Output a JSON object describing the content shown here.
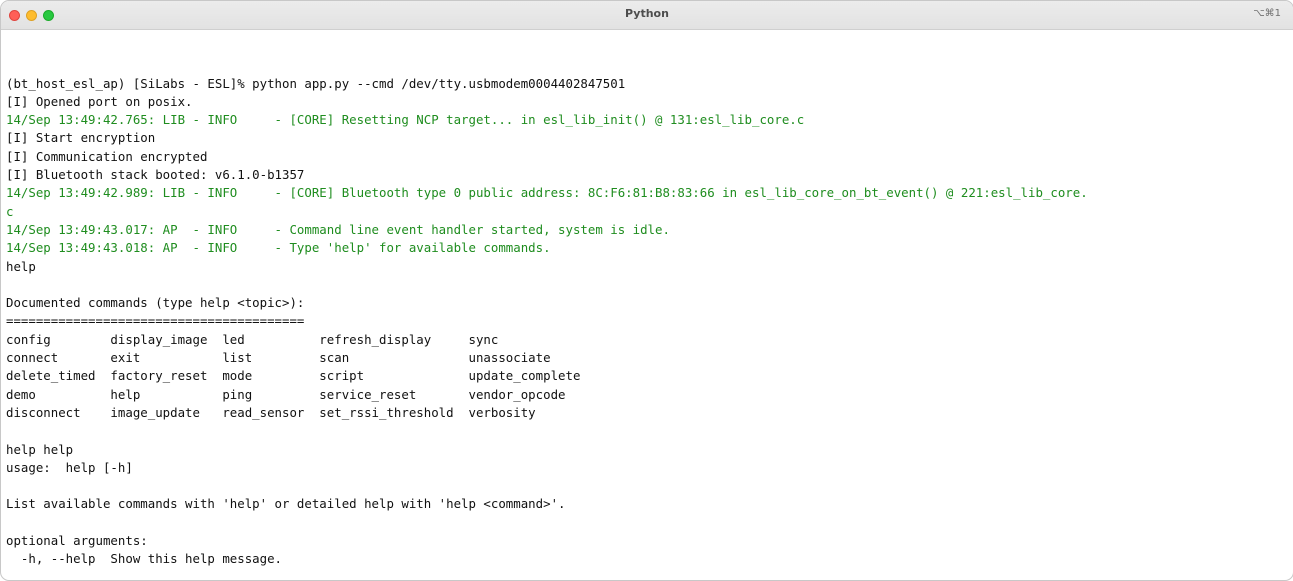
{
  "window": {
    "title": "Python",
    "shortcut": "⌥⌘1"
  },
  "terminal": {
    "lines": [
      {
        "text": "(bt_host_esl_ap) [SiLabs - ESL]% python app.py --cmd /dev/tty.usbmodem0004402847501",
        "style": "normal"
      },
      {
        "text": "[I] Opened port on posix.",
        "style": "normal"
      },
      {
        "text": "14/Sep 13:49:42.765: LIB - INFO     - [CORE] Resetting NCP target... in esl_lib_init() @ 131:esl_lib_core.c",
        "style": "green"
      },
      {
        "text": "[I] Start encryption",
        "style": "normal"
      },
      {
        "text": "[I] Communication encrypted",
        "style": "normal"
      },
      {
        "text": "[I] Bluetooth stack booted: v6.1.0-b1357",
        "style": "normal"
      },
      {
        "text": "14/Sep 13:49:42.989: LIB - INFO     - [CORE] Bluetooth type 0 public address: 8C:F6:81:B8:83:66 in esl_lib_core_on_bt_event() @ 221:esl_lib_core.",
        "style": "green"
      },
      {
        "text": "c",
        "style": "green"
      },
      {
        "text": "14/Sep 13:49:43.017: AP  - INFO     - Command line event handler started, system is idle.",
        "style": "green"
      },
      {
        "text": "14/Sep 13:49:43.018: AP  - INFO     - Type 'help' for available commands.",
        "style": "green"
      },
      {
        "text": "help",
        "style": "normal"
      },
      {
        "text": "",
        "style": "normal"
      },
      {
        "text": "Documented commands (type help <topic>):",
        "style": "normal"
      },
      {
        "text": "========================================",
        "style": "normal"
      },
      {
        "text": "config        display_image  led          refresh_display     sync",
        "style": "normal"
      },
      {
        "text": "connect       exit           list         scan                unassociate",
        "style": "normal"
      },
      {
        "text": "delete_timed  factory_reset  mode         script              update_complete",
        "style": "normal"
      },
      {
        "text": "demo          help           ping         service_reset       vendor_opcode",
        "style": "normal"
      },
      {
        "text": "disconnect    image_update   read_sensor  set_rssi_threshold  verbosity",
        "style": "normal"
      },
      {
        "text": "",
        "style": "normal"
      },
      {
        "text": "help help",
        "style": "normal"
      },
      {
        "text": "usage:  help [-h]",
        "style": "normal"
      },
      {
        "text": "",
        "style": "normal"
      },
      {
        "text": "List available commands with 'help' or detailed help with 'help <command>'.",
        "style": "normal"
      },
      {
        "text": "",
        "style": "normal"
      },
      {
        "text": "optional arguments:",
        "style": "normal"
      },
      {
        "text": "  -h, --help  Show this help message.",
        "style": "normal"
      },
      {
        "text": "",
        "style": "normal"
      }
    ]
  },
  "colors": {
    "log_green": "#1f8d1f",
    "text": "#111111",
    "background": "#ffffff"
  }
}
